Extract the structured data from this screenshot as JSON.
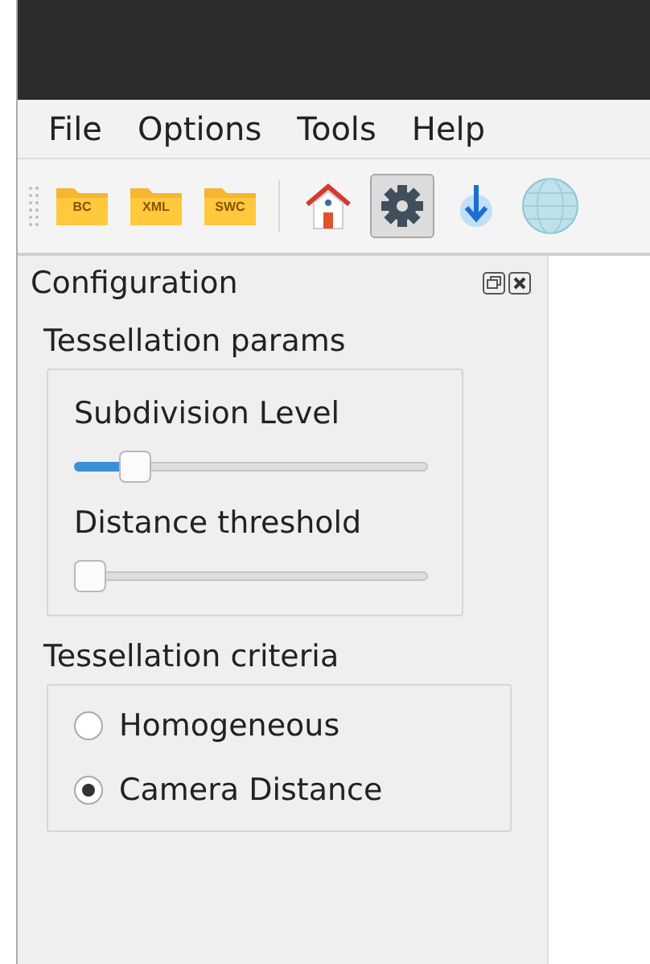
{
  "menu": [
    "File",
    "Options",
    "Tools",
    "Help"
  ],
  "toolbar": [
    {
      "kind": "folder",
      "label": "BC",
      "selected": false
    },
    {
      "kind": "folder",
      "label": "XML",
      "selected": false
    },
    {
      "kind": "folder",
      "label": "SWC",
      "selected": false
    },
    {
      "kind": "separator"
    },
    {
      "kind": "home",
      "selected": false
    },
    {
      "kind": "gear",
      "selected": true
    },
    {
      "kind": "download",
      "selected": false
    },
    {
      "kind": "sphere",
      "selected": false
    }
  ],
  "dock": {
    "title": "Configuration",
    "groups": [
      {
        "kind": "sliders",
        "title": "Tessellation params",
        "sliders": [
          {
            "label": "Subdivision Level",
            "level": 0.14
          },
          {
            "label": "Distance threshold",
            "level": 0.0
          }
        ]
      },
      {
        "kind": "radios",
        "title": "Tessellation criteria",
        "options": [
          {
            "label": "Homogeneous",
            "selected": false
          },
          {
            "label": "Camera Distance",
            "selected": true
          }
        ]
      }
    ]
  }
}
